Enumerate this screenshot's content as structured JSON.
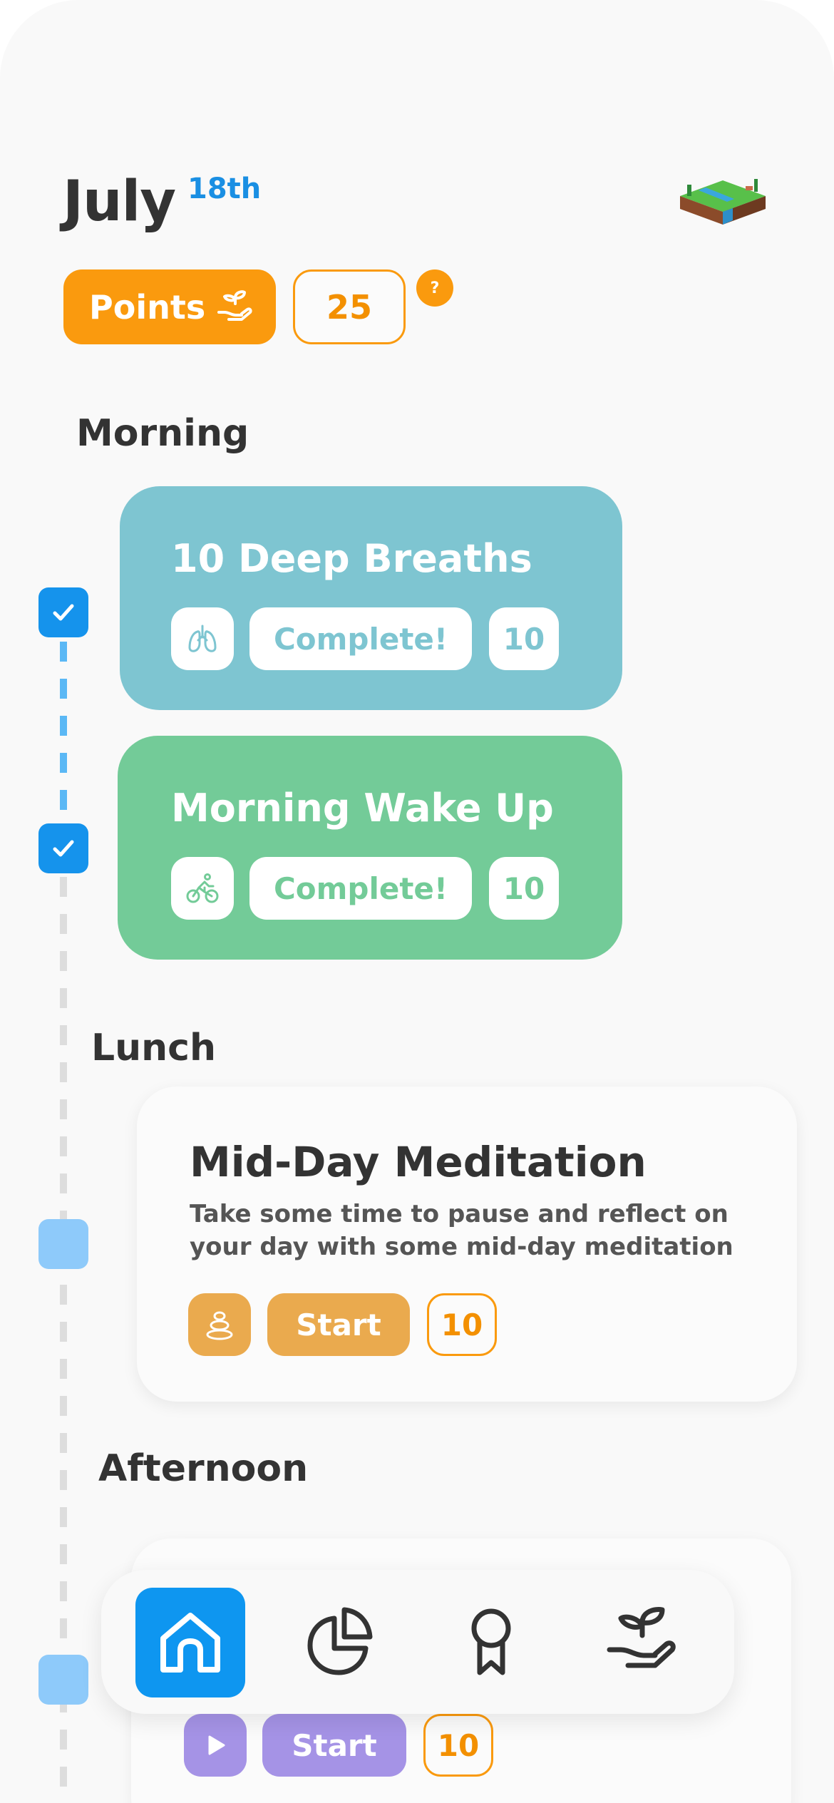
{
  "header": {
    "month": "July",
    "day": "18th"
  },
  "points": {
    "label": "Points",
    "count": "25",
    "help": "?"
  },
  "sections": {
    "morning": "Morning",
    "lunch": "Lunch",
    "afternoon": "Afternoon"
  },
  "tasks": [
    {
      "title": "10 Deep Breaths",
      "icon": "lungs-icon",
      "status": "Complete!",
      "points": "10",
      "color": "#7ec5d1",
      "done": true
    },
    {
      "title": "Morning Wake Up",
      "icon": "bicycle-icon",
      "status": "Complete!",
      "points": "10",
      "color": "#73cb98",
      "done": true
    },
    {
      "title": "Mid-Day Meditation",
      "description": "Take some time to pause and reflect on your day with some mid-day meditation",
      "icon": "stones-icon",
      "action": "Start",
      "points": "10",
      "color": "#eaaa4e",
      "done": false
    },
    {
      "icon": "play-icon",
      "action": "Start",
      "points": "10",
      "color": "#a593e6",
      "done": false
    }
  ],
  "nav": {
    "items": [
      "home-icon",
      "pie-chart-icon",
      "award-icon",
      "plant-hand-icon"
    ],
    "active": "home-icon"
  },
  "colors": {
    "accent": "#fa9a0e",
    "primary": "#0e96f0",
    "check": "#1593ec"
  }
}
